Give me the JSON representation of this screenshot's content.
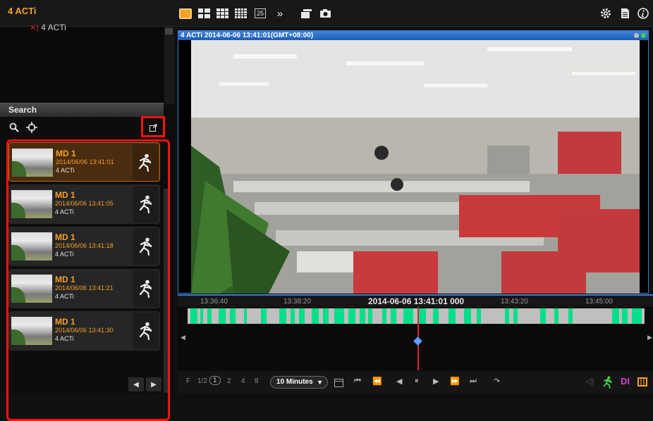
{
  "app": {
    "title": "4 ACTi"
  },
  "toolbar": {
    "layout_25_label": "25",
    "more_label": "»"
  },
  "tree": {
    "item_label": "4 ACTi"
  },
  "search": {
    "title": "Search",
    "results": [
      {
        "title": "MD 1",
        "time": "2014/06/06 13:41:01",
        "source": "4 ACTi",
        "selected": true
      },
      {
        "title": "MD 1",
        "time": "2014/06/06 13:41:05",
        "source": "4 ACTi",
        "selected": false
      },
      {
        "title": "MD 1",
        "time": "2014/06/06 13:41:18",
        "source": "4 ACTi",
        "selected": false
      },
      {
        "title": "MD 1",
        "time": "2014/06/06 13:41:21",
        "source": "4 ACTi",
        "selected": false
      },
      {
        "title": "MD 1",
        "time": "2014/06/06 13:41:30",
        "source": "4 ACTi",
        "selected": false
      }
    ]
  },
  "viewer": {
    "title": "4 ACTi  2014-06-06 13:41:01(GMT+08:00)"
  },
  "timeline": {
    "ticks": [
      "13:36:40",
      "13:38:20",
      "13:43:20",
      "13:45:00"
    ],
    "current": "2014-06-06 13:41:01 000"
  },
  "controls": {
    "frame_label": "F",
    "speeds": [
      "1/2",
      "1",
      "2",
      "4",
      "8"
    ],
    "range": "10 Minutes",
    "di_label": "DI"
  },
  "colors": {
    "accent": "#f6a025",
    "highlight_box": "#ff1010",
    "viewer_bar": "#3b7ad0",
    "record": "#00e08a"
  }
}
